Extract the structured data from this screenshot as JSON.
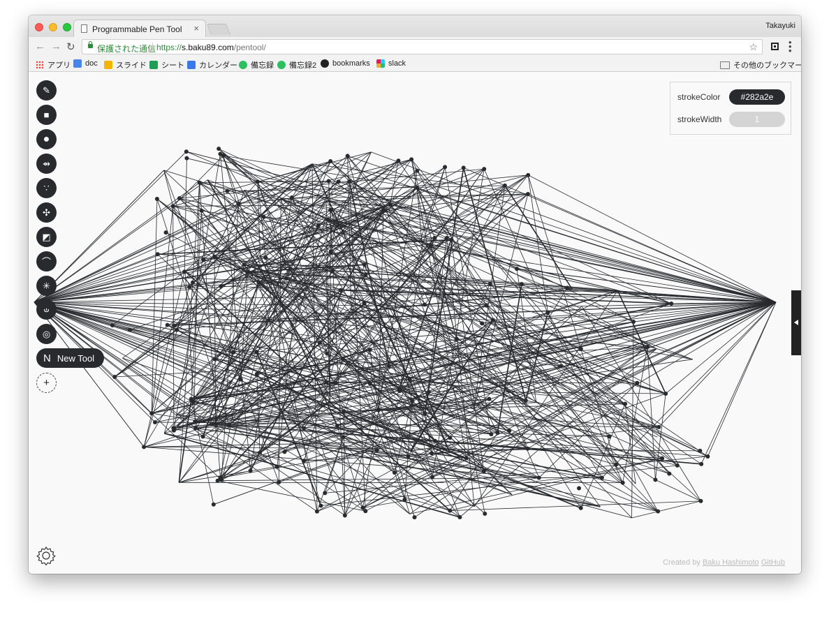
{
  "browser": {
    "tab_title": "Programmable Pen Tool",
    "tab_close": "×",
    "profile_name": "Takayuki",
    "nav_back": "←",
    "nav_forward": "→",
    "nav_reload": "↻",
    "secure_label": "保護された通信",
    "url_scheme": "https://",
    "url_host": "s.baku89.com",
    "url_path": "/pentool/",
    "bookmark_star": "☆",
    "menu_dots": "⋮"
  },
  "bookmarks": {
    "items": [
      {
        "label": "アプリ",
        "icon": "apps-grid-icon",
        "color": "#e8453c"
      },
      {
        "label": "doc",
        "icon": "docs-icon",
        "color": "#4a86e8"
      },
      {
        "label": "スライド",
        "icon": "slides-icon",
        "color": "#f6b400"
      },
      {
        "label": "シート",
        "icon": "sheets-icon",
        "color": "#1e9e57"
      },
      {
        "label": "カレンダー",
        "icon": "calendar-icon",
        "color": "#3b78e7"
      },
      {
        "label": "備忘録",
        "icon": "evernote-icon",
        "color": "#2dbe60"
      },
      {
        "label": "備忘録2",
        "icon": "evernote-icon",
        "color": "#2dbe60"
      },
      {
        "label": "bookmarks",
        "icon": "github-icon",
        "color": "#222222"
      },
      {
        "label": "slack",
        "icon": "slack-icon",
        "color": "#e01e5a"
      }
    ],
    "other": "その他のブックマーク"
  },
  "tools": [
    {
      "name": "pencil",
      "glyph": "✎"
    },
    {
      "name": "rectangle",
      "glyph": "■"
    },
    {
      "name": "ellipse",
      "glyph": "●"
    },
    {
      "name": "link",
      "glyph": "⇴"
    },
    {
      "name": "scatter",
      "glyph": "∵"
    },
    {
      "name": "move",
      "glyph": "✣"
    },
    {
      "name": "slash-box",
      "glyph": "◩"
    },
    {
      "name": "arc",
      "glyph": "⌒"
    },
    {
      "name": "asterisk",
      "glyph": "✳"
    },
    {
      "name": "loop",
      "glyph": "ഄ"
    },
    {
      "name": "concentric",
      "glyph": "◎"
    }
  ],
  "new_tool": {
    "letter": "N",
    "label": "New Tool"
  },
  "add_tool": "+",
  "panel": {
    "stroke_color_label": "strokeColor",
    "stroke_color_value": "#282a2e",
    "stroke_width_label": "strokeWidth",
    "stroke_width_value": "1"
  },
  "footer": {
    "credit_prefix": "Created by",
    "author": "Baku Hashimoto",
    "github": "GitHub"
  },
  "colors": {
    "stroke": "#282a2e",
    "accent_secure": "#2e8b3a"
  }
}
